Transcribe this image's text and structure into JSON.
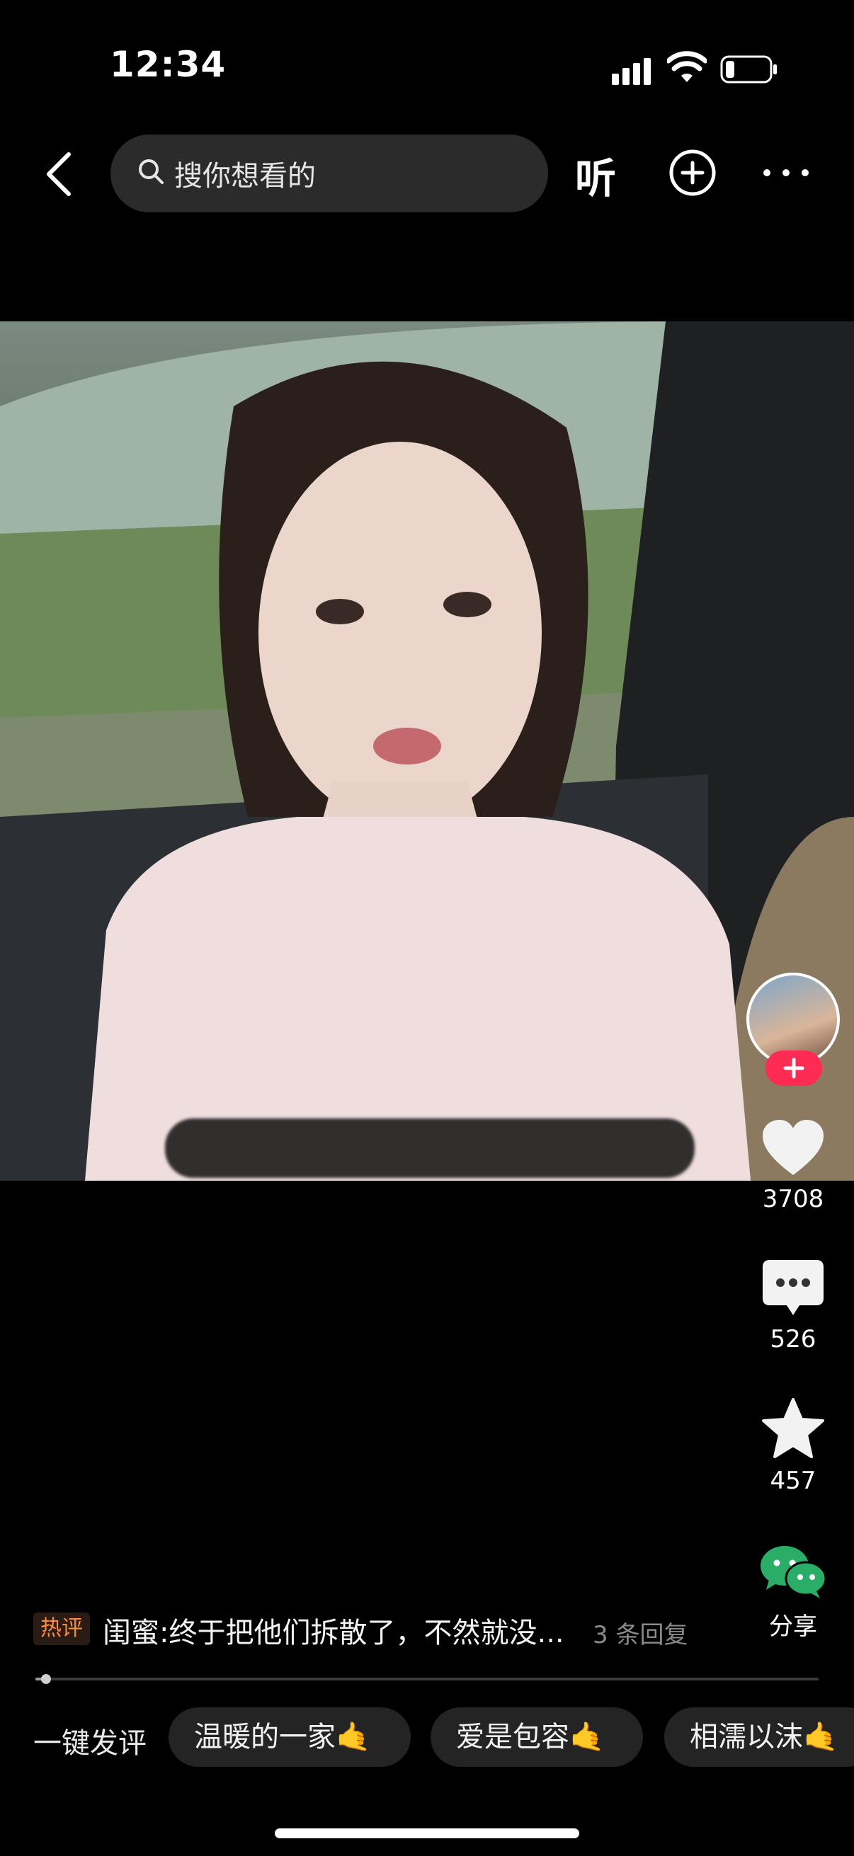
{
  "status_bar": {
    "time": "12:34"
  },
  "top_nav": {
    "search_placeholder": "搜你想看的",
    "listen_label": "听"
  },
  "actions": {
    "likes": "3708",
    "comments": "526",
    "favorites": "457",
    "share_label": "分享"
  },
  "hot_comment": {
    "tag": "热评",
    "text": "闺蜜:终于把他们拆散了，不然就没...",
    "replies": "3 条回复"
  },
  "progress": {
    "fraction": 0.014
  },
  "quick_comment": {
    "label": "一键发评",
    "chips": [
      "温暖的一家",
      "爱是包容",
      "相濡以沫"
    ],
    "chip_emoji": "🤙"
  },
  "colors": {
    "follow_badge": "#fe2c55",
    "hot_tag": "#ff8a3d",
    "wechat_green": "#2aae67"
  }
}
